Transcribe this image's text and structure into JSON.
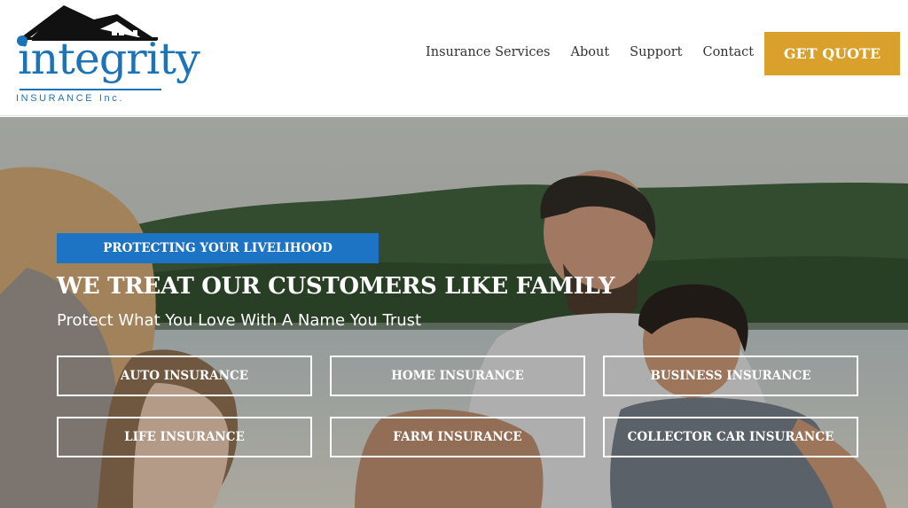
{
  "brand": {
    "logo_word": "integrity",
    "logo_sub": "INSURANCE Inc.",
    "logo_icon": "house-roof-icon",
    "color_primary": "#1d73b7"
  },
  "nav": {
    "items": [
      {
        "label": "Insurance Services"
      },
      {
        "label": "About"
      },
      {
        "label": "Support"
      },
      {
        "label": "Contact"
      }
    ],
    "cta": "GET QUOTE",
    "cta_color": "#d9a12b"
  },
  "hero": {
    "tagline": "PROTECTING YOUR LIVELIHOOD",
    "tagline_color": "#1d73c4",
    "headline": "WE TREAT OUR CUSTOMERS LIKE FAMILY",
    "subheadline": "Protect What You Love With A Name You Trust",
    "background_image": "family-lakeside-photo",
    "services": [
      {
        "label": "AUTO INSURANCE"
      },
      {
        "label": "HOME INSURANCE"
      },
      {
        "label": "BUSINESS INSURANCE"
      },
      {
        "label": "LIFE INSURANCE"
      },
      {
        "label": "FARM INSURANCE"
      },
      {
        "label": "COLLECTOR CAR INSURANCE"
      }
    ]
  }
}
